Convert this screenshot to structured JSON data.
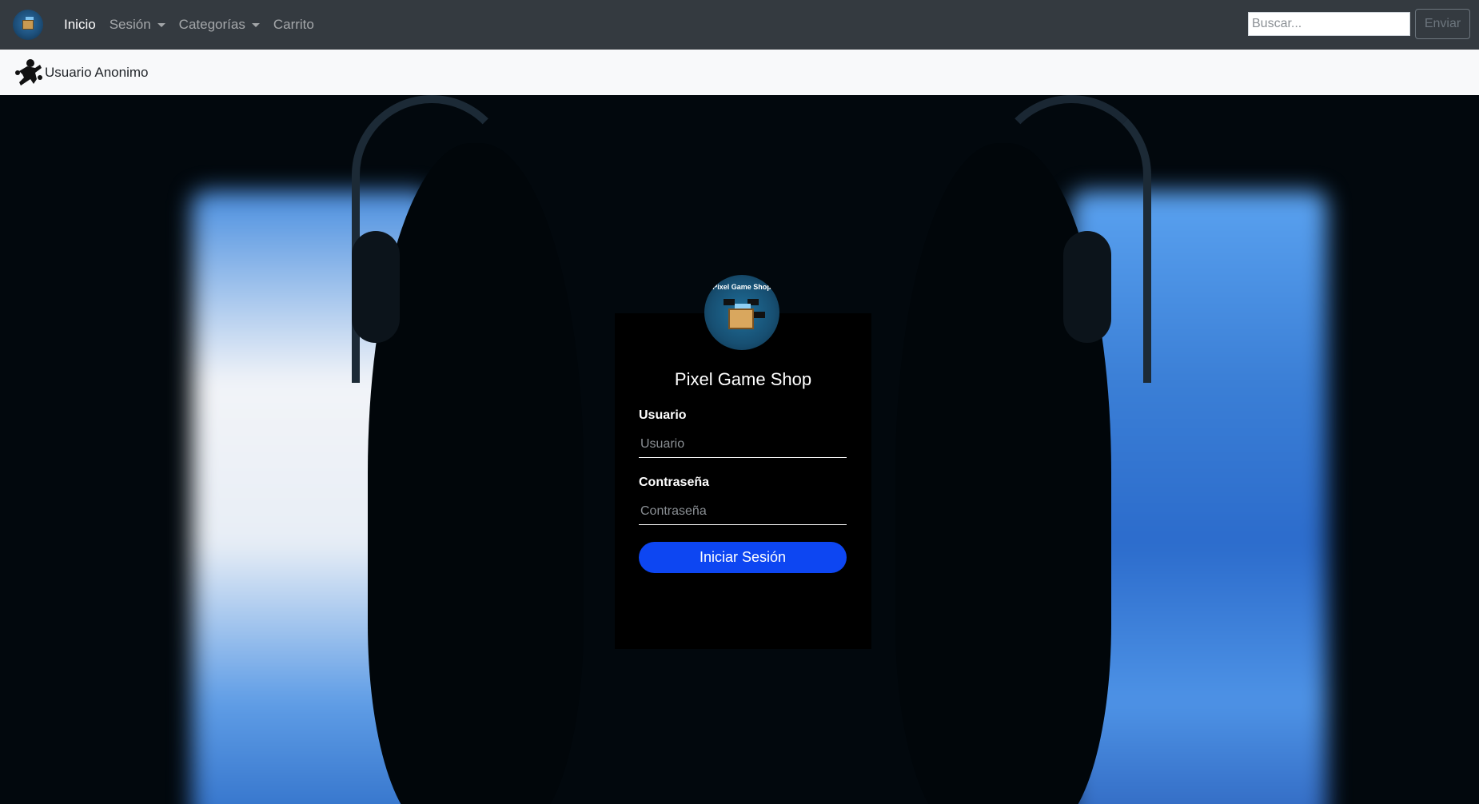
{
  "navbar": {
    "brand_icon": "pixel-game-shop-logo-icon",
    "links": [
      {
        "label": "Inicio",
        "active": true
      },
      {
        "label": "Sesión",
        "dropdown": true
      },
      {
        "label": "Categorías",
        "dropdown": true
      },
      {
        "label": "Carrito"
      }
    ],
    "search": {
      "placeholder": "Buscar...",
      "button_label": "Enviar"
    }
  },
  "userbar": {
    "icon": "player-silhouette-icon",
    "username": "Usuario Anonimo"
  },
  "login": {
    "logo_text": "Pixel Game Shop",
    "title": "Pixel Game Shop",
    "user_label": "Usuario",
    "user_placeholder": "Usuario",
    "password_label": "Contraseña",
    "password_placeholder": "Contraseña",
    "submit_label": "Iniciar Sesión"
  },
  "colors": {
    "navbar_bg": "#343a40",
    "userbar_bg": "#f8f9fa",
    "card_bg": "#000000",
    "button_bg": "#0d46f2"
  }
}
